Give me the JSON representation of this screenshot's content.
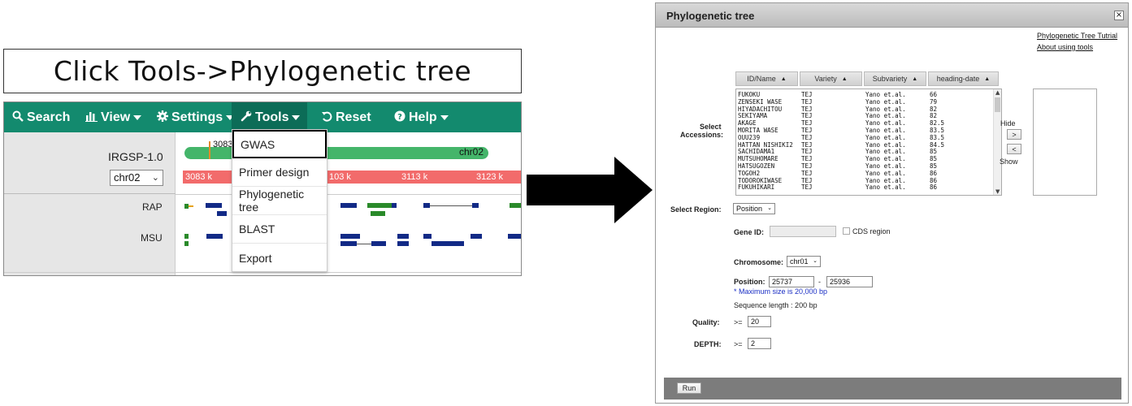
{
  "caption": "Click Tools->Phylogenetic tree",
  "navbar": {
    "search": "Search",
    "view": "View",
    "settings": "Settings",
    "tools": "Tools",
    "reset": "Reset",
    "help": "Help"
  },
  "browser": {
    "reference": "IRGSP-1.0",
    "chromosome_select": "chr02",
    "chromosome_bar_label": "chr02",
    "marker_text": "3083",
    "ruler_ticks": [
      "3083 k",
      "103 k",
      "3113 k",
      "3123 k"
    ],
    "tracks": [
      "RAP",
      "MSU"
    ]
  },
  "tools_menu": {
    "items": [
      "GWAS",
      "Primer design",
      "Phylogenetic tree",
      "BLAST",
      "Export"
    ],
    "highlighted": "GWAS"
  },
  "dialog": {
    "title": "Phylogenetic tree",
    "close_glyph": "×",
    "links": [
      "Phylogenetic Tree Tutrial",
      "About using tools"
    ],
    "columns": [
      "ID/Name",
      "Variety",
      "Subvariety",
      "heading-date"
    ],
    "select_accessions_label": [
      "Select",
      "Accessions:"
    ],
    "accessions": [
      {
        "name": "FUKOKU",
        "variety": "TEJ",
        "subvariety": "Yano et.al.",
        "heading": "66"
      },
      {
        "name": "ZENSEKI WASE",
        "variety": "TEJ",
        "subvariety": "Yano et.al.",
        "heading": "79"
      },
      {
        "name": "HIYADACHITOU",
        "variety": "TEJ",
        "subvariety": "Yano et.al.",
        "heading": "82"
      },
      {
        "name": "SEKIYAMA",
        "variety": "TEJ",
        "subvariety": "Yano et.al.",
        "heading": "82"
      },
      {
        "name": "AKAGE",
        "variety": "TEJ",
        "subvariety": "Yano et.al.",
        "heading": "82.5"
      },
      {
        "name": "MORITA WASE",
        "variety": "TEJ",
        "subvariety": "Yano et.al.",
        "heading": "83.5"
      },
      {
        "name": "OUU239",
        "variety": "TEJ",
        "subvariety": "Yano et.al.",
        "heading": "83.5"
      },
      {
        "name": "HATTAN NISHIKI2",
        "variety": "TEJ",
        "subvariety": "Yano et.al.",
        "heading": "84.5"
      },
      {
        "name": "SACHIDAMA1",
        "variety": "TEJ",
        "subvariety": "Yano et.al.",
        "heading": "85"
      },
      {
        "name": "MUTSUHOMARE",
        "variety": "TEJ",
        "subvariety": "Yano et.al.",
        "heading": "85"
      },
      {
        "name": "HATSUGOZEN",
        "variety": "TEJ",
        "subvariety": "Yano et.al.",
        "heading": "85"
      },
      {
        "name": "TOGOH2",
        "variety": "TEJ",
        "subvariety": "Yano et.al.",
        "heading": "86"
      },
      {
        "name": "TODOROKIWASE",
        "variety": "TEJ",
        "subvariety": "Yano et.al.",
        "heading": "86"
      },
      {
        "name": "FUKUHIKARI",
        "variety": "TEJ",
        "subvariety": "Yano et.al.",
        "heading": "86"
      }
    ],
    "hide_label": "Hide",
    "show_label": "Show",
    "move_right": ">",
    "move_left": "<",
    "select_region_label": "Select Region:",
    "region_value": "Position",
    "gene_id_label": "Gene ID:",
    "gene_id_value": "",
    "cds_label": "CDS region",
    "chromosome_label": "Chromosome:",
    "chromosome_value": "chr01",
    "position_label": "Position:",
    "position_start": "25737",
    "position_dash": "-",
    "position_end": "25936",
    "max_note": "* Maximum size is 20,000 bp",
    "sequence_length": "Sequence length :  200 bp",
    "quality_label": "Quality:",
    "quality_op": ">=",
    "quality_value": "20",
    "depth_label": "DEPTH:",
    "depth_op": ">=",
    "depth_value": "2",
    "run_label": "Run"
  }
}
